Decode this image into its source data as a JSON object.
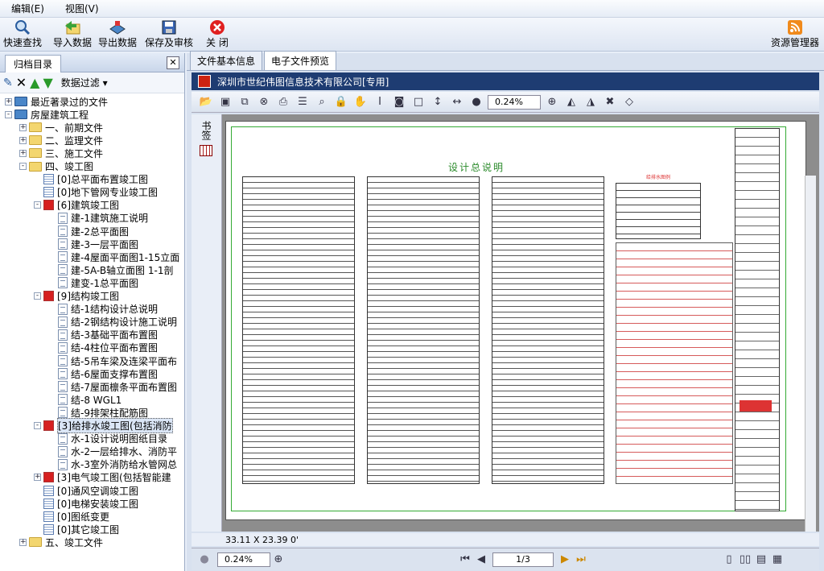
{
  "menu": [
    "编辑(E)",
    "视图(V)"
  ],
  "toolbar": {
    "quick_search": "快速查找",
    "import": "导入数据",
    "export": "导出数据",
    "save_review": "保存及审核",
    "close": "关 闭",
    "resource_manager": "资源管理器"
  },
  "left_panel": {
    "tab": "归档目录",
    "filter": "数据过滤"
  },
  "tree": [
    {
      "label": "最近著录过的文件",
      "level": 0,
      "icon": "recent",
      "exp": "+"
    },
    {
      "label": "房屋建筑工程",
      "level": 0,
      "icon": "recent",
      "exp": "-"
    },
    {
      "label": "一、前期文件",
      "level": 1,
      "icon": "folder",
      "exp": "+"
    },
    {
      "label": "二、监理文件",
      "level": 1,
      "icon": "folder",
      "exp": "+"
    },
    {
      "label": "三、施工文件",
      "level": 1,
      "icon": "folder",
      "exp": "+"
    },
    {
      "label": "四、竣工图",
      "level": 1,
      "icon": "folder",
      "exp": "-"
    },
    {
      "label": "[0]总平面布置竣工图",
      "level": 2,
      "icon": "grid"
    },
    {
      "label": "[0]地下管网专业竣工图",
      "level": 2,
      "icon": "grid"
    },
    {
      "label": "[6]建筑竣工图",
      "level": 2,
      "icon": "chk",
      "exp": "-"
    },
    {
      "label": "建-1建筑施工说明",
      "level": 3,
      "icon": "doc"
    },
    {
      "label": "建-2总平面图",
      "level": 3,
      "icon": "doc"
    },
    {
      "label": "建-3一层平面图",
      "level": 3,
      "icon": "doc"
    },
    {
      "label": "建-4屋面平面图1-15立面",
      "level": 3,
      "icon": "doc"
    },
    {
      "label": "建-5A-B轴立面图 1-1剖",
      "level": 3,
      "icon": "doc"
    },
    {
      "label": "建变-1总平面图",
      "level": 3,
      "icon": "doc"
    },
    {
      "label": "[9]结构竣工图",
      "level": 2,
      "icon": "chk",
      "exp": "-"
    },
    {
      "label": "结-1结构设计总说明",
      "level": 3,
      "icon": "doc"
    },
    {
      "label": "结-2钢结构设计施工说明",
      "level": 3,
      "icon": "doc"
    },
    {
      "label": "结-3基础平面布置图",
      "level": 3,
      "icon": "doc"
    },
    {
      "label": "结-4柱位平面布置图",
      "level": 3,
      "icon": "doc"
    },
    {
      "label": "结-5吊车梁及连梁平面布",
      "level": 3,
      "icon": "doc"
    },
    {
      "label": "结-6屋面支撑布置图",
      "level": 3,
      "icon": "doc"
    },
    {
      "label": "结-7屋面檩条平面布置图",
      "level": 3,
      "icon": "doc"
    },
    {
      "label": "结-8 WGL1",
      "level": 3,
      "icon": "doc"
    },
    {
      "label": "结-9排架柱配筋图",
      "level": 3,
      "icon": "doc"
    },
    {
      "label": "[3]给排水竣工图(包括消防",
      "level": 2,
      "icon": "chk",
      "exp": "-",
      "selected": true
    },
    {
      "label": "水-1设计说明图纸目录",
      "level": 3,
      "icon": "doc"
    },
    {
      "label": "水-2一层给排水、消防平",
      "level": 3,
      "icon": "doc"
    },
    {
      "label": "水-3室外消防给水管网总",
      "level": 3,
      "icon": "doc"
    },
    {
      "label": "[3]电气竣工图(包括智能建",
      "level": 2,
      "icon": "chk",
      "exp": "+"
    },
    {
      "label": "[0]通风空调竣工图",
      "level": 2,
      "icon": "grid"
    },
    {
      "label": "[0]电梯安装竣工图",
      "level": 2,
      "icon": "grid"
    },
    {
      "label": "[0]图纸变更",
      "level": 2,
      "icon": "grid"
    },
    {
      "label": "[0]其它竣工图",
      "level": 2,
      "icon": "grid"
    },
    {
      "label": "五、竣工文件",
      "level": 1,
      "icon": "folder",
      "exp": "+"
    }
  ],
  "tabs": [
    "文件基本信息",
    "电子文件预览"
  ],
  "viewer": {
    "title": "深圳市世纪伟图信息技术有限公司[专用]",
    "zoom": "0.24%",
    "side_label": "书签",
    "sheet_title": "设计总说明",
    "legend_title": "给排水图例",
    "status": "33.11 X 23.39 0'",
    "page": "1/3",
    "bottom_zoom": "0.24%"
  }
}
